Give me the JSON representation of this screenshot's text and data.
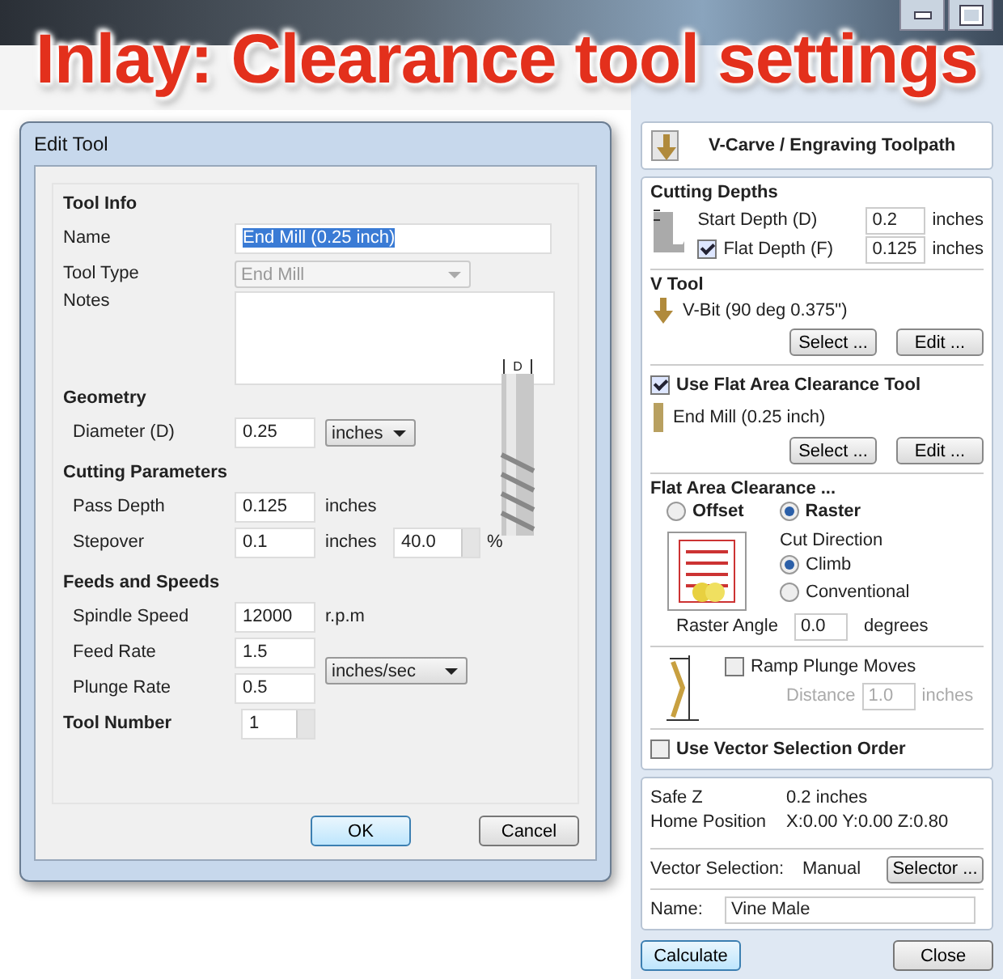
{
  "caption": "Inlay: Clearance tool settings",
  "dialog": {
    "title": "Edit Tool",
    "tool_info": {
      "heading": "Tool Info",
      "name_label": "Name",
      "name_value": "End Mill (0.25 inch)",
      "type_label": "Tool Type",
      "type_value": "End Mill",
      "notes_label": "Notes"
    },
    "geometry": {
      "heading": "Geometry",
      "diameter_label": "Diameter (D)",
      "diameter_value": "0.25",
      "unit": "inches",
      "diagram_label": "D"
    },
    "cutting": {
      "heading": "Cutting Parameters",
      "pass_label": "Pass Depth",
      "pass_value": "0.125",
      "pass_unit": "inches",
      "stepover_label": "Stepover",
      "stepover_value": "0.1",
      "stepover_unit": "inches",
      "stepover_percent": "40.0",
      "percent_sign": "%"
    },
    "feeds": {
      "heading": "Feeds and Speeds",
      "spindle_label": "Spindle Speed",
      "spindle_value": "12000",
      "spindle_unit": "r.p.m",
      "feed_label": "Feed Rate",
      "feed_value": "1.5",
      "plunge_label": "Plunge Rate",
      "plunge_value": "0.5",
      "rate_unit": "inches/sec"
    },
    "tool_number": {
      "label": "Tool Number",
      "value": "1"
    },
    "ok": "OK",
    "cancel": "Cancel"
  },
  "panel": {
    "title": "V-Carve / Engraving Toolpath",
    "cutting_depths": {
      "heading": "Cutting Depths",
      "start_label": "Start Depth (D)",
      "start_value": "0.2",
      "start_unit": "inches",
      "flat_label": "Flat Depth (F)",
      "flat_checked": true,
      "flat_value": "0.125",
      "flat_unit": "inches"
    },
    "v_tool": {
      "heading": "V Tool",
      "tool": "V-Bit (90 deg 0.375\")",
      "select": "Select ...",
      "edit": "Edit ..."
    },
    "clearance_tool": {
      "label": "Use Flat Area Clearance Tool",
      "checked": true,
      "tool": "End Mill (0.25 inch)",
      "select": "Select ...",
      "edit": "Edit ..."
    },
    "flat_area": {
      "heading": "Flat Area Clearance ...",
      "strategies": [
        {
          "label": "Offset",
          "selected": false
        },
        {
          "label": "Raster",
          "selected": true
        }
      ],
      "cut_direction_label": "Cut Direction",
      "directions": [
        {
          "label": "Climb",
          "selected": true
        },
        {
          "label": "Conventional",
          "selected": false
        }
      ],
      "angle_label": "Raster Angle",
      "angle_value": "0.0",
      "angle_unit": "degrees"
    },
    "ramp": {
      "label": "Ramp Plunge Moves",
      "checked": false,
      "distance_label": "Distance",
      "distance_value": "1.0",
      "distance_unit": "inches"
    },
    "vector_order": {
      "label": "Use Vector Selection Order",
      "checked": false
    },
    "info": [
      {
        "label": "Safe Z",
        "value": "0.2 inches"
      },
      {
        "label": "Home Position",
        "value": "X:0.00 Y:0.00 Z:0.80"
      }
    ],
    "vector_selection": {
      "label": "Vector Selection:",
      "value": "Manual",
      "button": "Selector ..."
    },
    "name": {
      "label": "Name:",
      "value": "Vine Male"
    },
    "calculate": "Calculate",
    "close": "Close"
  }
}
